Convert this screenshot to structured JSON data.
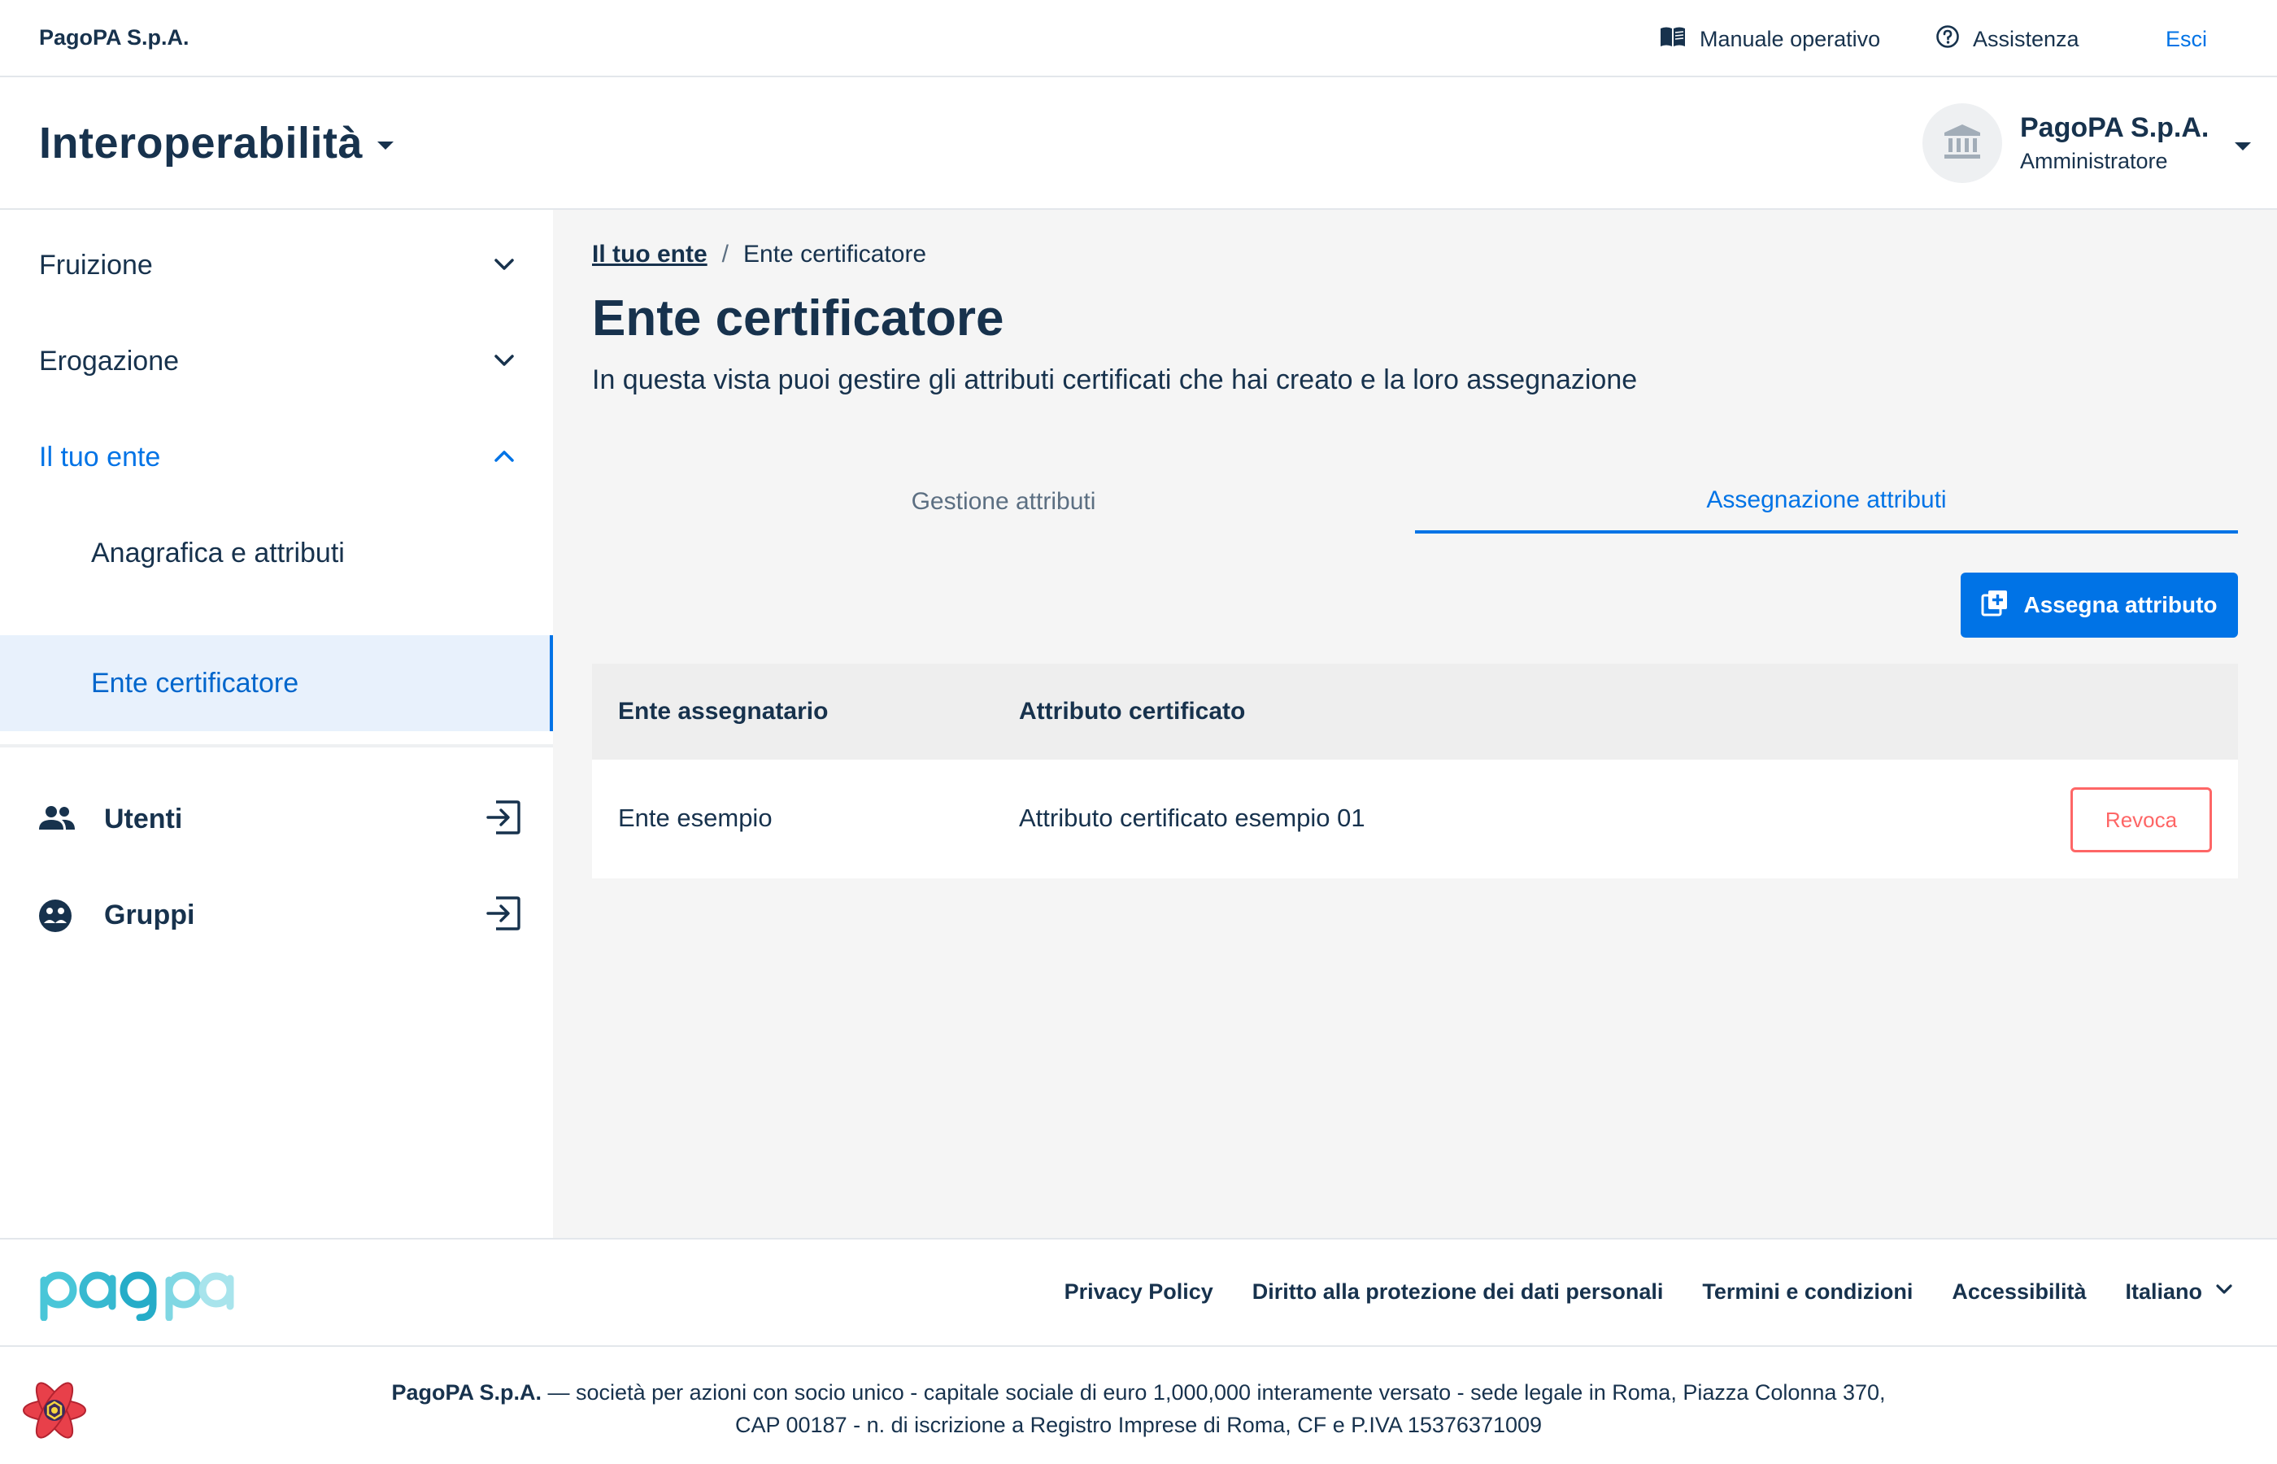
{
  "header": {
    "brand": "PagoPA S.p.A.",
    "manual_label": "Manuale operativo",
    "help_label": "Assistenza",
    "logout_label": "Esci"
  },
  "product": {
    "title": "Interoperabilità"
  },
  "party": {
    "name": "PagoPA S.p.A.",
    "role": "Amministratore"
  },
  "sidebar": {
    "items": [
      {
        "label": "Fruizione"
      },
      {
        "label": "Erogazione"
      },
      {
        "label": "Il tuo ente"
      },
      {
        "label": "Anagrafica e attributi"
      },
      {
        "label": "Ente certificatore"
      },
      {
        "label": "Utenti"
      },
      {
        "label": "Gruppi"
      }
    ]
  },
  "breadcrumb": {
    "parent": "Il tuo ente",
    "separator": "/",
    "current": "Ente certificatore"
  },
  "page": {
    "title": "Ente certificatore",
    "subtitle": "In questa vista puoi gestire gli attributi certificati che hai creato e la loro assegnazione"
  },
  "tabs": [
    {
      "label": "Gestione attributi"
    },
    {
      "label": "Assegnazione attributi"
    }
  ],
  "actions": {
    "assign_label": "Assegna attributo"
  },
  "table": {
    "headers": [
      "Ente assegnatario",
      "Attributo certificato"
    ],
    "rows": [
      {
        "ente": "Ente esempio",
        "attributo": "Attributo certificato esempio 01",
        "action": "Revoca"
      }
    ]
  },
  "footer": {
    "links": [
      "Privacy Policy",
      "Diritto alla protezione dei dati personali",
      "Termini e condizioni",
      "Accessibilità"
    ],
    "language": "Italiano",
    "legal_company": "PagoPA S.p.A.",
    "legal_line1": " — società per azioni con socio unico - capitale sociale di euro 1,000,000 interamente versato - sede legale in Roma, Piazza Colonna 370,",
    "legal_line2": "CAP 00187 - n. di iscrizione a Registro Imprese di Roma, CF e P.IVA 15376371009"
  },
  "colors": {
    "primary": "#0073e6",
    "text": "#17324d",
    "danger": "#fe6666",
    "active_bg": "#e8f1fc"
  }
}
